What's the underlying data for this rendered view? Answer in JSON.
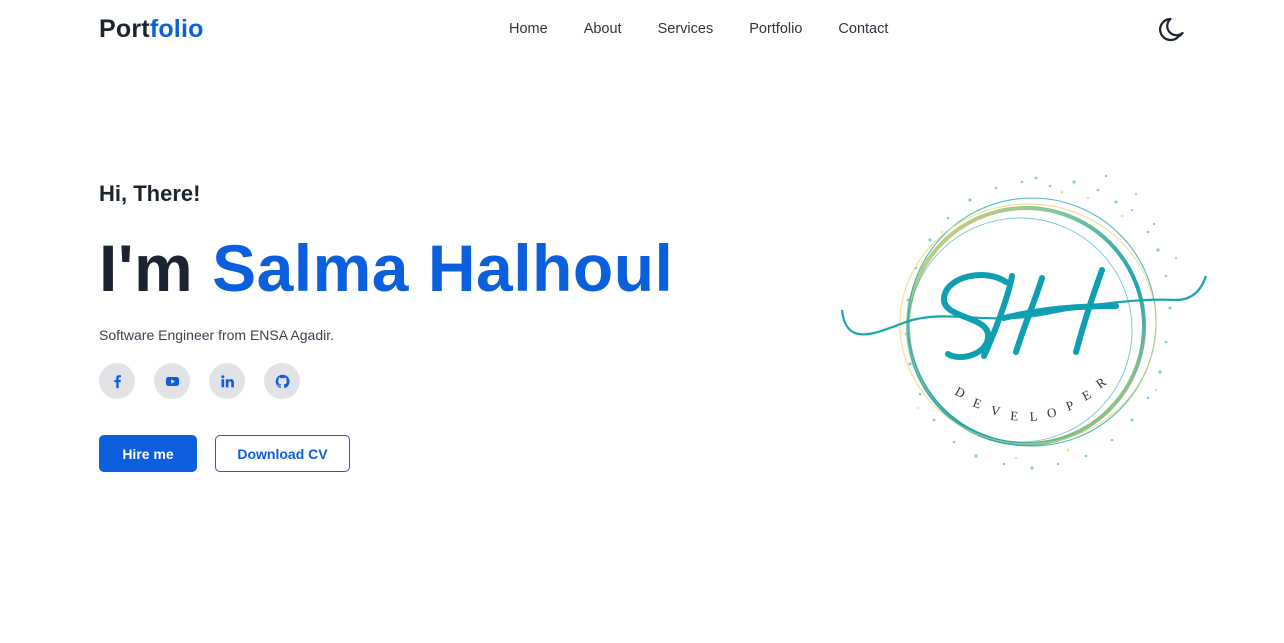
{
  "brand": {
    "part1": "Port",
    "part2": "folio"
  },
  "nav": {
    "items": [
      "Home",
      "About",
      "Services",
      "Portfolio",
      "Contact"
    ]
  },
  "theme_toggle_icon": "moon-icon",
  "hero": {
    "greeting": "Hi, There!",
    "headline_prefix": "I'm",
    "name": "Salma Halhoul",
    "tagline": "Software Engineer from ENSA Agadir.",
    "socials": [
      "facebook-icon",
      "youtube-icon",
      "linkedin-icon",
      "github-icon"
    ],
    "hire_label": "Hire me",
    "cv_label": "Download CV"
  },
  "emblem": {
    "monogram": "SH",
    "caption": "DEVELOPER"
  },
  "colors": {
    "accent": "#0c5fdc",
    "text": "#1b2430",
    "emblem_teal": "#1aa3b3",
    "emblem_gold": "#e9d46a"
  }
}
